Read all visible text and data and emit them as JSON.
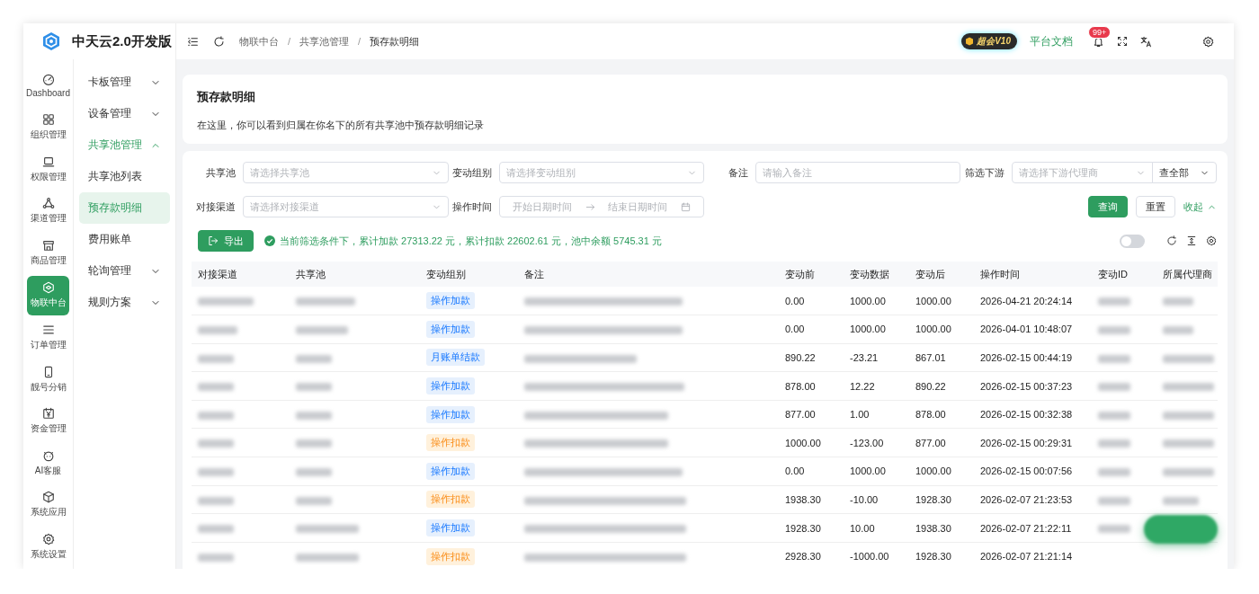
{
  "brand": {
    "name": "中天云2.0开发版"
  },
  "rail": [
    {
      "label": "Dashboard",
      "selected": false
    },
    {
      "label": "组织管理",
      "selected": false
    },
    {
      "label": "权限管理",
      "selected": false
    },
    {
      "label": "渠道管理",
      "selected": false
    },
    {
      "label": "商品管理",
      "selected": false
    },
    {
      "label": "物联中台",
      "selected": true
    },
    {
      "label": "订单管理",
      "selected": false
    },
    {
      "label": "靓号分销",
      "selected": false
    },
    {
      "label": "资金管理",
      "selected": false
    },
    {
      "label": "AI客服",
      "selected": false
    },
    {
      "label": "系统应用",
      "selected": false
    },
    {
      "label": "系统设置",
      "selected": false
    }
  ],
  "submenu": [
    {
      "label": "卡板管理",
      "expanded": false
    },
    {
      "label": "设备管理",
      "expanded": false
    },
    {
      "label": "共享池管理",
      "expanded": true,
      "children": [
        {
          "label": "共享池列表",
          "selected": false
        },
        {
          "label": "预存款明细",
          "selected": true
        },
        {
          "label": "费用账单",
          "selected": false
        }
      ]
    },
    {
      "label": "轮询管理",
      "expanded": false
    },
    {
      "label": "规则方案",
      "expanded": false
    }
  ],
  "topbar": {
    "breadcrumb": [
      "物联中台",
      "共享池管理",
      "预存款明细"
    ],
    "breadcrumb_separators": [
      "/",
      "/"
    ],
    "vip_badge": "超会V10",
    "docs_link": "平台文档",
    "notification_count": "99+"
  },
  "page_header": {
    "title": "预存款明细",
    "description": "在这里，你可以看到归属在你名下的所有共享池中预存款明细记录"
  },
  "filters": [
    {
      "label": "共享池",
      "kind": "select",
      "placeholder": "请选择共享池"
    },
    {
      "label": "变动组别",
      "kind": "select",
      "placeholder": "请选择变动组别"
    },
    {
      "label": "备注",
      "kind": "input",
      "placeholder": "请输入备注"
    },
    {
      "label": "筛选下游",
      "kind": "select-pair",
      "placeholder": "请选择下游代理商",
      "value": "查全部"
    },
    {
      "label": "对接渠道",
      "kind": "select",
      "placeholder": "请选择对接渠道"
    },
    {
      "label": "操作时间",
      "kind": "daterange",
      "start_placeholder": "开始日期时间",
      "end_placeholder": "结束日期时间"
    }
  ],
  "filter_actions": {
    "search": "查询",
    "reset": "重置",
    "collapse": "收起"
  },
  "toolbar": {
    "export": "导出",
    "summary": "当前筛选条件下，累计加款 27313.22 元，累计扣款 22602.61 元，池中余额 5745.31 元",
    "toggle_on": false
  },
  "table": {
    "columns": [
      "对接渠道",
      "共享池",
      "变动组别",
      "备注",
      "变动前",
      "变动数据",
      "变动后",
      "操作时间",
      "变动ID",
      "所属代理商"
    ],
    "rows": [
      {
        "group": {
          "text": "操作加款",
          "color": "#e6f0fd"
        },
        "before": "0.00",
        "change": "1000.00",
        "after": "1000.00",
        "time": "2026-04-21 20:24:14"
      },
      {
        "group": {
          "text": "操作加款",
          "color": "#e6f0fd"
        },
        "before": "0.00",
        "change": "1000.00",
        "after": "1000.00",
        "time": "2026-04-01 10:48:07"
      },
      {
        "group": {
          "text": "月账单结款",
          "color": "#e6f0fd"
        },
        "before": "890.22",
        "change": "-23.21",
        "after": "867.01",
        "time": "2026-02-15 00:44:19"
      },
      {
        "group": {
          "text": "操作加款",
          "color": "#e6f0fd"
        },
        "before": "878.00",
        "change": "12.22",
        "after": "890.22",
        "time": "2026-02-15 00:37:23"
      },
      {
        "group": {
          "text": "操作加款",
          "color": "#e6f0fd"
        },
        "before": "877.00",
        "change": "1.00",
        "after": "878.00",
        "time": "2026-02-15 00:32:38"
      },
      {
        "group": {
          "text": "操作扣款",
          "color": "#fff1dc"
        },
        "before": "1000.00",
        "change": "-123.00",
        "after": "877.00",
        "time": "2026-02-15 00:29:31"
      },
      {
        "group": {
          "text": "操作加款",
          "color": "#e6f0fd"
        },
        "before": "0.00",
        "change": "1000.00",
        "after": "1000.00",
        "time": "2026-02-15 00:07:56"
      },
      {
        "group": {
          "text": "操作扣款",
          "color": "#fff1dc"
        },
        "before": "1938.30",
        "change": "-10.00",
        "after": "1928.30",
        "time": "2026-02-07 21:23:53"
      },
      {
        "group": {
          "text": "操作加款",
          "color": "#e6f0fd"
        },
        "before": "1928.30",
        "change": "10.00",
        "after": "1938.30",
        "time": "2026-02-07 21:22:11"
      },
      {
        "group": {
          "text": "操作扣款",
          "color": "#fff1dc"
        },
        "before": "2928.30",
        "change": "-1000.00",
        "after": "1928.30",
        "time": "2026-02-07 21:21:14"
      }
    ]
  }
}
